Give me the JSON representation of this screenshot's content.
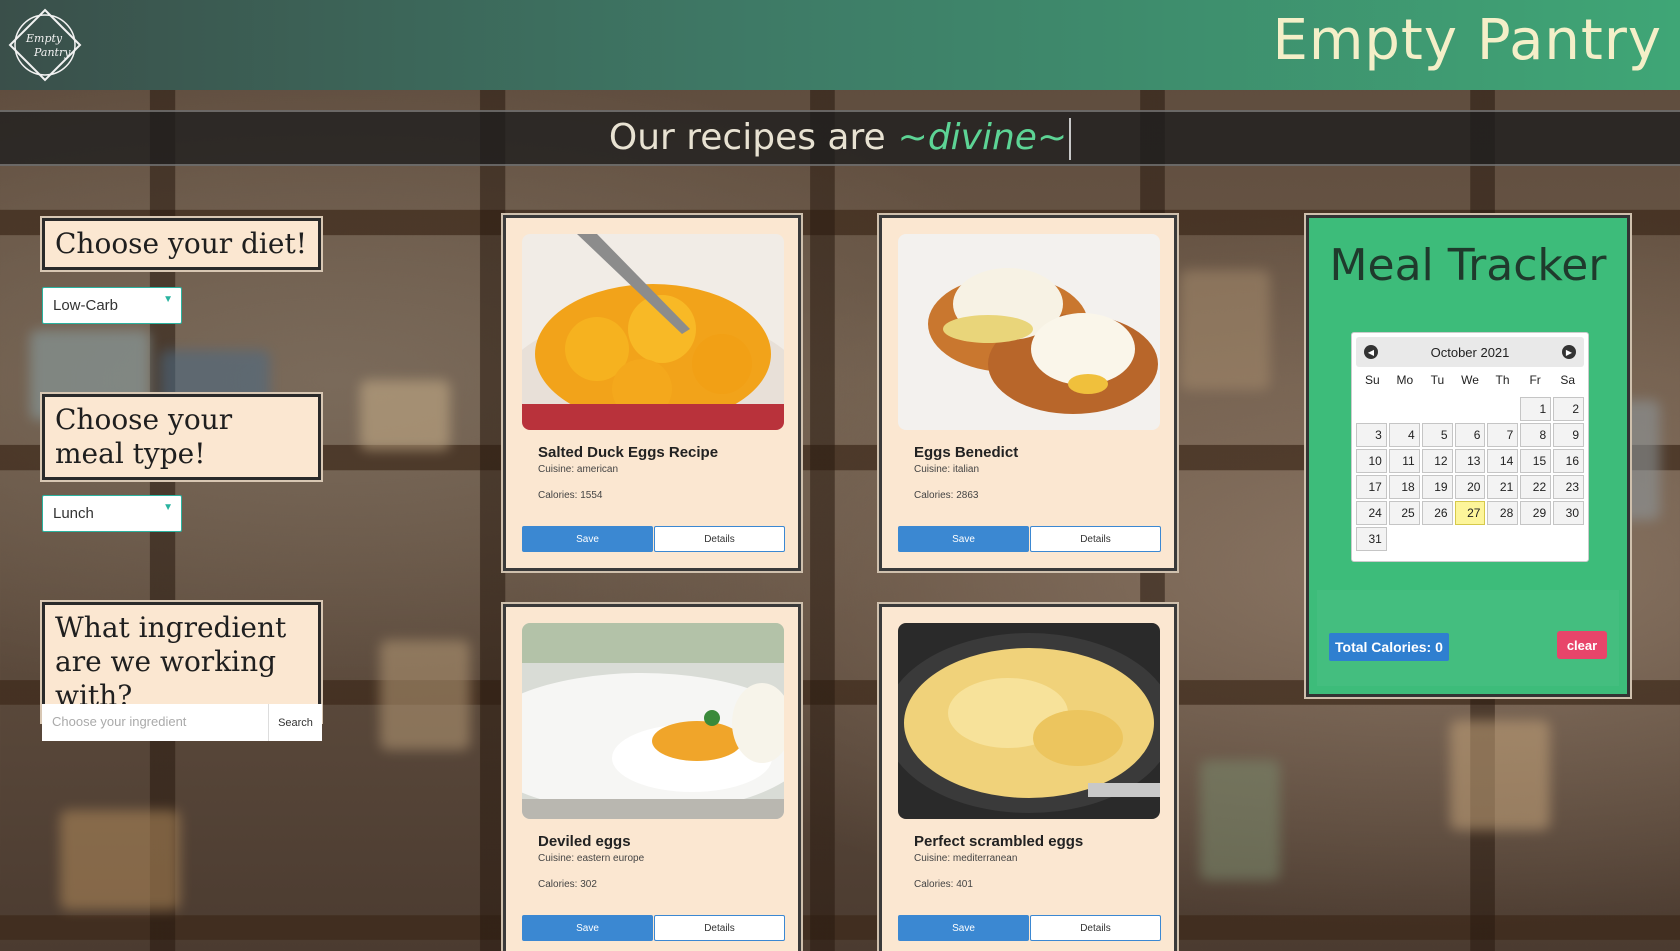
{
  "header": {
    "logo_text_line1": "Empty",
    "logo_text_line2": "Pantry",
    "brand": "Empty Pantry"
  },
  "banner": {
    "prefix": "Our recipes are",
    "accent": "~divine~"
  },
  "filters": {
    "diet_label": "Choose your diet!",
    "diet_value": "Low-Carb",
    "meal_label": "Choose your meal type!",
    "meal_value": "Lunch",
    "ingredient_label": "What ingredient are we working with?",
    "ingredient_placeholder": "Choose your ingredient",
    "search_label": "Search"
  },
  "cards": [
    {
      "title": "Salted Duck Eggs Recipe",
      "cuisine": "Cuisine: american",
      "calories": "Calories: 1554",
      "save": "Save",
      "details": "Details"
    },
    {
      "title": "Eggs Benedict",
      "cuisine": "Cuisine: italian",
      "calories": "Calories: 2863",
      "save": "Save",
      "details": "Details"
    },
    {
      "title": "Deviled eggs",
      "cuisine": "Cuisine: eastern europe",
      "calories": "Calories: 302",
      "save": "Save",
      "details": "Details"
    },
    {
      "title": "Perfect scrambled eggs",
      "cuisine": "Cuisine: mediterranean",
      "calories": "Calories: 401",
      "save": "Save",
      "details": "Details"
    }
  ],
  "tracker": {
    "title": "Meal Tracker",
    "month": "October 2021",
    "dow": [
      "Su",
      "Mo",
      "Tu",
      "We",
      "Th",
      "Fr",
      "Sa"
    ],
    "total": "Total Calories: 0",
    "clear": "clear",
    "today": "27"
  },
  "colors": {
    "accent_green": "#3dbc7a",
    "card_bg": "#fbe7d1",
    "save_blue": "#3b88d2",
    "clear_red": "#e8456a"
  }
}
